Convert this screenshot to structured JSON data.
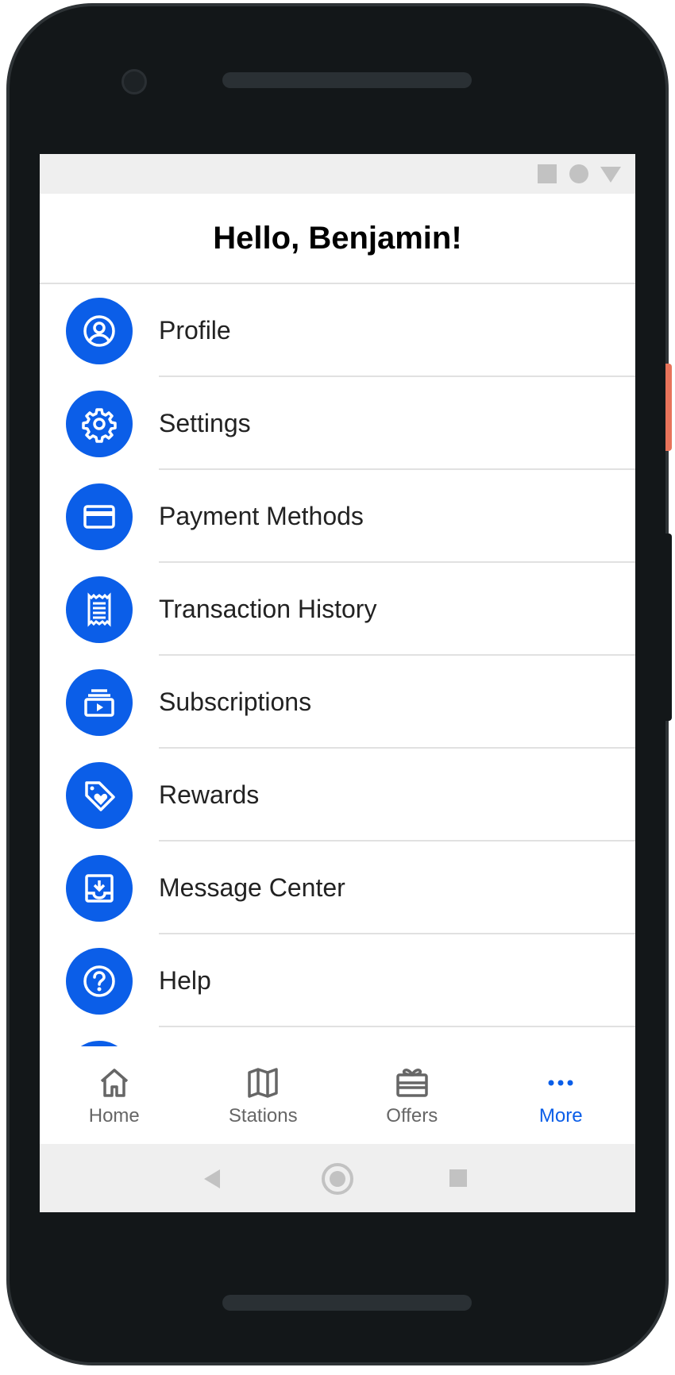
{
  "header": {
    "title": "Hello, Benjamin!"
  },
  "menu": {
    "items": [
      {
        "label": "Profile",
        "icon": "profile-icon"
      },
      {
        "label": "Settings",
        "icon": "gear-icon"
      },
      {
        "label": "Payment Methods",
        "icon": "credit-card-icon"
      },
      {
        "label": "Transaction History",
        "icon": "receipt-icon"
      },
      {
        "label": "Subscriptions",
        "icon": "subscriptions-icon"
      },
      {
        "label": "Rewards",
        "icon": "tag-heart-icon"
      },
      {
        "label": "Message Center",
        "icon": "inbox-download-icon"
      },
      {
        "label": "Help",
        "icon": "help-icon"
      }
    ]
  },
  "bottom_nav": {
    "items": [
      {
        "label": "Home",
        "icon": "home-icon",
        "active": false
      },
      {
        "label": "Stations",
        "icon": "map-icon",
        "active": false
      },
      {
        "label": "Offers",
        "icon": "gift-card-icon",
        "active": false
      },
      {
        "label": "More",
        "icon": "more-dots-icon",
        "active": true
      }
    ]
  },
  "colors": {
    "accent": "#0b5ee8",
    "inactive": "#666666",
    "divider": "#e1e1e1"
  }
}
